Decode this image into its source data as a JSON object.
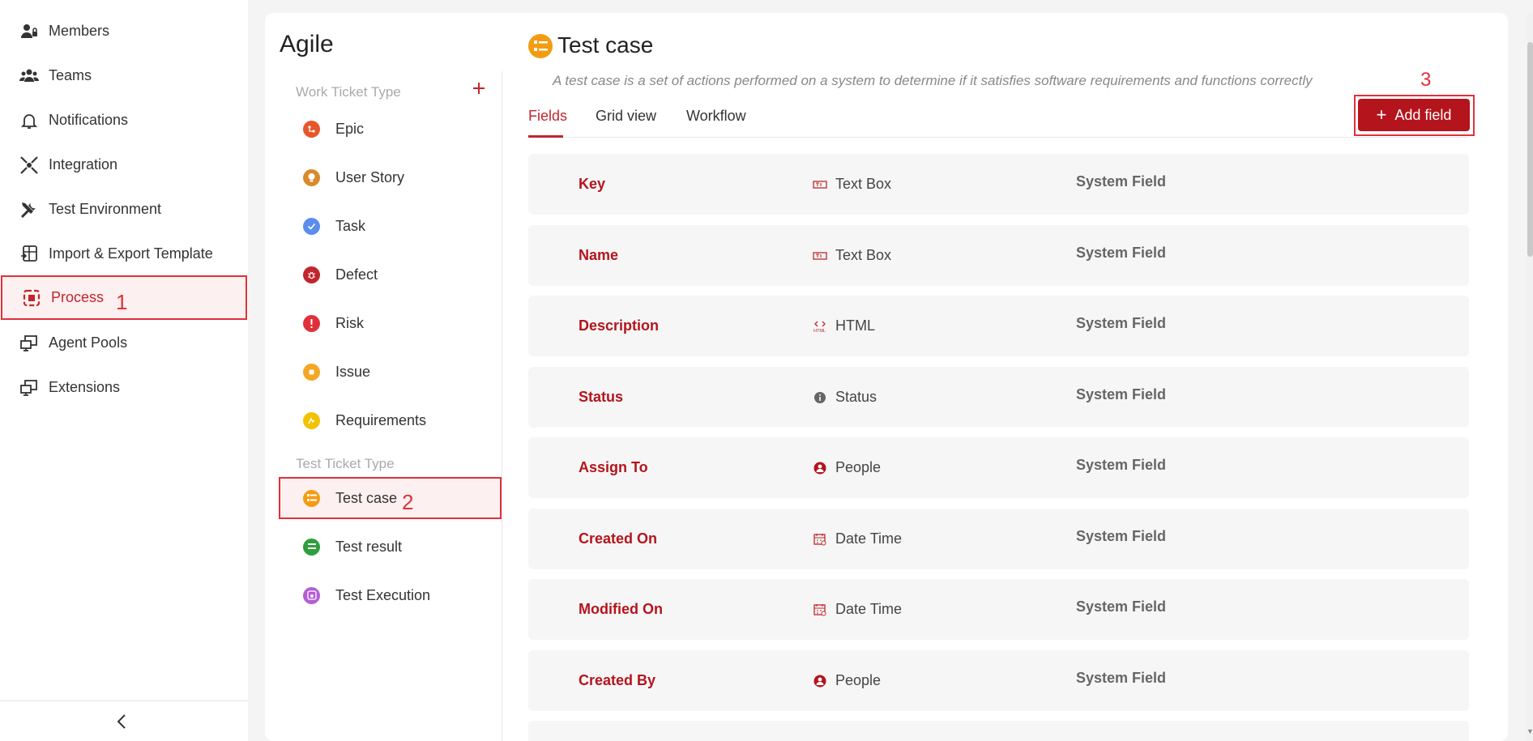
{
  "sidebar": {
    "items": [
      {
        "label": "Members",
        "icon": "members-icon"
      },
      {
        "label": "Teams",
        "icon": "teams-icon"
      },
      {
        "label": "Notifications",
        "icon": "bell-icon"
      },
      {
        "label": "Integration",
        "icon": "integration-icon"
      },
      {
        "label": "Test Environment",
        "icon": "tools-icon"
      },
      {
        "label": "Import & Export Template",
        "icon": "template-icon"
      },
      {
        "label": "Process",
        "icon": "process-icon",
        "active": true
      },
      {
        "label": "Agent Pools",
        "icon": "agent-pools-icon"
      },
      {
        "label": "Extensions",
        "icon": "extensions-icon"
      }
    ],
    "collapse_icon": "chevron-left-icon"
  },
  "annotations": {
    "step1": "1",
    "step2": "2",
    "step3": "3"
  },
  "process": {
    "title": "Agile",
    "work_section": "Work Ticket Type",
    "test_section": "Test Ticket Type",
    "work_types": [
      {
        "label": "Epic",
        "color": "#e8552a"
      },
      {
        "label": "User Story",
        "color": "#d98a2b"
      },
      {
        "label": "Task",
        "color": "#5b8def"
      },
      {
        "label": "Defect",
        "color": "#c0262d"
      },
      {
        "label": "Risk",
        "color": "#e0313a"
      },
      {
        "label": "Issue",
        "color": "#f5a623"
      },
      {
        "label": "Requirements",
        "color": "#f2c200"
      }
    ],
    "test_types": [
      {
        "label": "Test case",
        "color": "#f39c12",
        "active": true
      },
      {
        "label": "Test result",
        "color": "#2e9e3e"
      },
      {
        "label": "Test Execution",
        "color": "#b45cd6"
      }
    ]
  },
  "detail": {
    "title": "Test case",
    "description": "A test case is a set of actions performed on a system to determine if it satisfies software requirements and functions correctly",
    "tabs": [
      "Fields",
      "Grid view",
      "Workflow"
    ],
    "active_tab": "Fields",
    "add_field_label": "Add field",
    "accent": "#b4141c",
    "fields": [
      {
        "name": "Key",
        "type": "Text Box",
        "type_icon": "textbox-icon",
        "kind": "System Field"
      },
      {
        "name": "Name",
        "type": "Text Box",
        "type_icon": "textbox-icon",
        "kind": "System Field"
      },
      {
        "name": "Description",
        "type": "HTML",
        "type_icon": "html-icon",
        "kind": "System Field"
      },
      {
        "name": "Status",
        "type": "Status",
        "type_icon": "info-icon",
        "kind": "System Field"
      },
      {
        "name": "Assign To",
        "type": "People",
        "type_icon": "person-icon",
        "kind": "System Field"
      },
      {
        "name": "Created On",
        "type": "Date Time",
        "type_icon": "calendar-icon",
        "kind": "System Field"
      },
      {
        "name": "Modified On",
        "type": "Date Time",
        "type_icon": "calendar-icon",
        "kind": "System Field"
      },
      {
        "name": "Created By",
        "type": "People",
        "type_icon": "person-icon",
        "kind": "System Field"
      }
    ]
  }
}
